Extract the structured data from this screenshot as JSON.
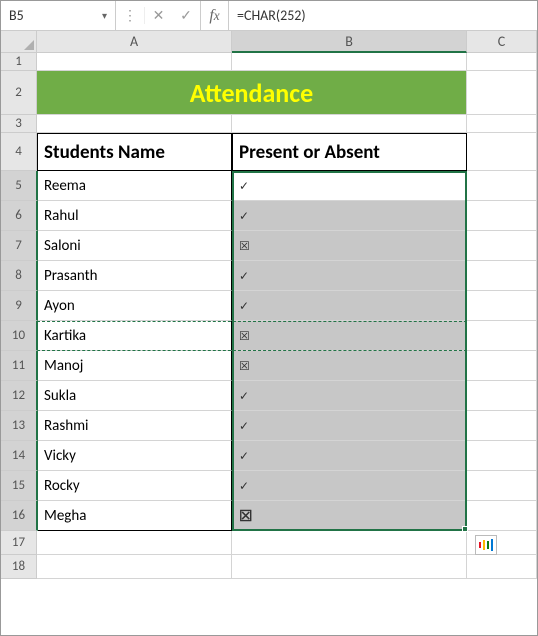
{
  "namebox": {
    "ref": "B5"
  },
  "formula_bar": {
    "value": "=CHAR(252)"
  },
  "columns": [
    "A",
    "B",
    "C"
  ],
  "row_numbers": [
    1,
    2,
    3,
    4,
    5,
    6,
    7,
    8,
    9,
    10,
    11,
    12,
    13,
    14,
    15,
    16,
    17,
    18
  ],
  "title": "Attendance",
  "headers": {
    "col_a": "Students Name",
    "col_b": "Present or Absent"
  },
  "students": [
    {
      "name": "Reema",
      "mark": "check"
    },
    {
      "name": "Rahul",
      "mark": "check"
    },
    {
      "name": "Saloni",
      "mark": "cross"
    },
    {
      "name": "Prasanth",
      "mark": "check"
    },
    {
      "name": "Ayon",
      "mark": "check"
    },
    {
      "name": "Kartika",
      "mark": "cross"
    },
    {
      "name": "Manoj",
      "mark": "cross"
    },
    {
      "name": "Sukla",
      "mark": "check"
    },
    {
      "name": "Rashmi",
      "mark": "check"
    },
    {
      "name": "Vicky",
      "mark": "check"
    },
    {
      "name": "Rocky",
      "mark": "check"
    },
    {
      "name": "Megha",
      "mark": "cross-big"
    }
  ],
  "icons": {
    "check": "✓",
    "cross": "☒",
    "cross-big": "☒"
  },
  "selection": {
    "active": "B5",
    "range": "B5:B16",
    "copied": "A10:B10"
  }
}
